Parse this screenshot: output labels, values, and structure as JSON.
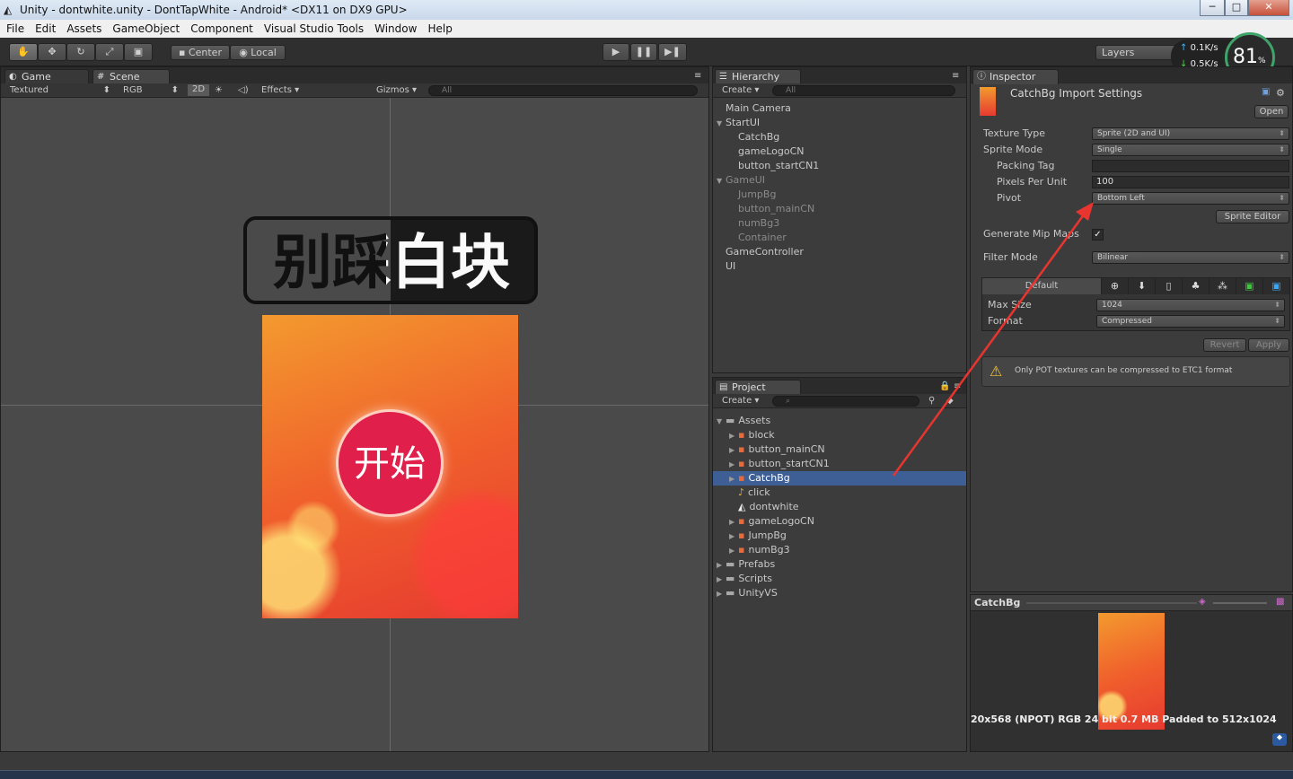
{
  "titlebar": {
    "title": "Unity - dontwhite.unity - DontTapWhite - Android* <DX11 on DX9 GPU>",
    "minimize": "─",
    "maximize": "□",
    "close": "✕"
  },
  "menu": [
    "File",
    "Edit",
    "Assets",
    "GameObject",
    "Component",
    "Visual Studio Tools",
    "Window",
    "Help"
  ],
  "toolbar": {
    "center": "Center",
    "local": "Local",
    "layers": "Layers",
    "net_up": "0.1K/s",
    "net_down": "0.5K/s",
    "cpu": "81",
    "cpu_unit": "%"
  },
  "game_tab": "Game",
  "scene_tab": "Scene",
  "scene_bar": {
    "textured": "Textured",
    "rgb": "RGB",
    "mode2d": "2D",
    "effects": "Effects",
    "gizmos": "Gizmos",
    "search": "All"
  },
  "scene": {
    "logo_text": "别踩白块儿",
    "start_button": "开始"
  },
  "hierarchy": {
    "tab": "Hierarchy",
    "create": "Create",
    "search": "All",
    "items": [
      {
        "label": "Main Camera",
        "indent": 0,
        "arrow": "",
        "dim": false
      },
      {
        "label": "StartUI",
        "indent": 0,
        "arrow": "▼",
        "dim": false
      },
      {
        "label": "CatchBg",
        "indent": 1,
        "arrow": "",
        "dim": false
      },
      {
        "label": "gameLogoCN",
        "indent": 1,
        "arrow": "",
        "dim": false
      },
      {
        "label": "button_startCN1",
        "indent": 1,
        "arrow": "",
        "dim": false
      },
      {
        "label": "GameUI",
        "indent": 0,
        "arrow": "▼",
        "dim": true
      },
      {
        "label": "JumpBg",
        "indent": 1,
        "arrow": "",
        "dim": true
      },
      {
        "label": "button_mainCN",
        "indent": 1,
        "arrow": "",
        "dim": true
      },
      {
        "label": "numBg3",
        "indent": 1,
        "arrow": "",
        "dim": true
      },
      {
        "label": "Container",
        "indent": 1,
        "arrow": "",
        "dim": true
      },
      {
        "label": "GameController",
        "indent": 0,
        "arrow": "",
        "dim": false
      },
      {
        "label": "UI",
        "indent": 0,
        "arrow": "",
        "dim": false
      }
    ]
  },
  "project": {
    "tab": "Project",
    "create": "Create",
    "items": [
      {
        "label": "Assets",
        "indent": 0,
        "arrow": "▼",
        "icon": "folder",
        "sel": false
      },
      {
        "label": "block",
        "indent": 1,
        "arrow": "▶",
        "icon": "sprite",
        "sel": false
      },
      {
        "label": "button_mainCN",
        "indent": 1,
        "arrow": "▶",
        "icon": "sprite",
        "sel": false
      },
      {
        "label": "button_startCN1",
        "indent": 1,
        "arrow": "▶",
        "icon": "sprite",
        "sel": false
      },
      {
        "label": "CatchBg",
        "indent": 1,
        "arrow": "▶",
        "icon": "sprite",
        "sel": true
      },
      {
        "label": "click",
        "indent": 1,
        "arrow": "",
        "icon": "audio",
        "sel": false
      },
      {
        "label": "dontwhite",
        "indent": 1,
        "arrow": "",
        "icon": "unity",
        "sel": false
      },
      {
        "label": "gameLogoCN",
        "indent": 1,
        "arrow": "▶",
        "icon": "sprite",
        "sel": false
      },
      {
        "label": "JumpBg",
        "indent": 1,
        "arrow": "▶",
        "icon": "sprite",
        "sel": false
      },
      {
        "label": "numBg3",
        "indent": 1,
        "arrow": "▶",
        "icon": "sprite",
        "sel": false
      },
      {
        "label": "Prefabs",
        "indent": 0,
        "arrow": "▶",
        "icon": "folder",
        "sel": false
      },
      {
        "label": "Scripts",
        "indent": 0,
        "arrow": "▶",
        "icon": "folder",
        "sel": false
      },
      {
        "label": "UnityVS",
        "indent": 0,
        "arrow": "▶",
        "icon": "folder",
        "sel": false
      }
    ]
  },
  "inspector": {
    "tab": "Inspector",
    "title": "CatchBg Import Settings",
    "open": "Open",
    "texture_type_label": "Texture Type",
    "texture_type": "Sprite (2D and UI)",
    "sprite_mode_label": "Sprite Mode",
    "sprite_mode": "Single",
    "packing_tag_label": "Packing Tag",
    "packing_tag": "",
    "ppu_label": "Pixels Per Unit",
    "ppu": "100",
    "pivot_label": "Pivot",
    "pivot": "Bottom Left",
    "sprite_editor": "Sprite Editor",
    "mipmaps_label": "Generate Mip Maps",
    "mipmaps_check": "✓",
    "filter_label": "Filter Mode",
    "filter": "Bilinear",
    "default_tab": "Default",
    "max_size_label": "Max Size",
    "max_size": "1024",
    "format_label": "Format",
    "format": "Compressed",
    "revert": "Revert",
    "apply": "Apply",
    "warning": "Only POT textures can be compressed to ETC1 format"
  },
  "preview": {
    "title": "CatchBg",
    "info": "20x568 (NPOT)  RGB 24 bit   0.7 MB   Padded to 512x1024"
  },
  "colors": {
    "accent": "#3e5f96",
    "arrow": "#e8352f",
    "bg_orange": "#f07a2a",
    "button_red": "#e0204a"
  }
}
